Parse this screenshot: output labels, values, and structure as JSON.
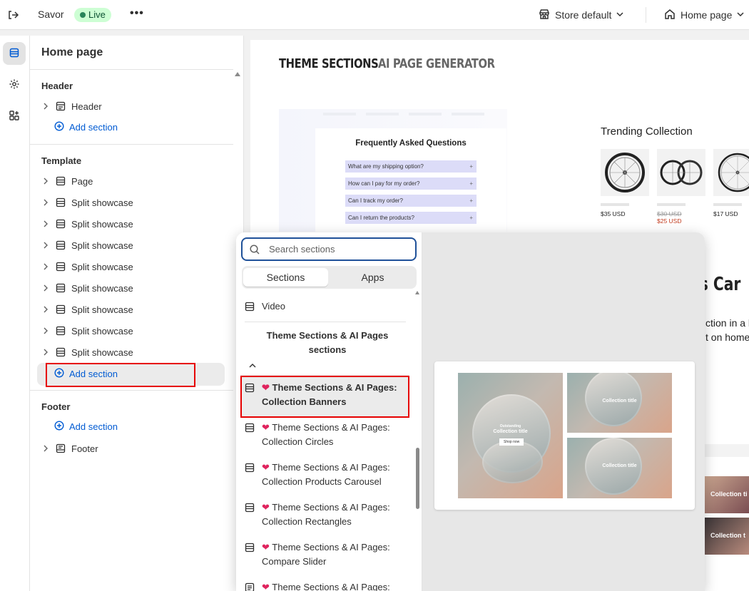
{
  "topbar": {
    "store_name": "Savor",
    "status": "Live",
    "more": "•••",
    "theme_label": "Store default",
    "page_label": "Home page"
  },
  "sidebar": {
    "title": "Home page",
    "header_group": "Header",
    "header_item": "Header",
    "template_group": "Template",
    "template_items": [
      "Page",
      "Split showcase",
      "Split showcase",
      "Split showcase",
      "Split showcase",
      "Split showcase",
      "Split showcase",
      "Split showcase",
      "Split showcase"
    ],
    "footer_group": "Footer",
    "footer_item": "Footer",
    "add_section": "Add section"
  },
  "preview": {
    "tab1": "THEME SECTIONS",
    "tab2": "AI PAGE GENERATOR",
    "faq_title": "Frequently Asked Questions",
    "faq_items": [
      "What are my shipping option?",
      "How can I pay for my order?",
      "Can I track my order?",
      "Can I return the products?"
    ],
    "trending_title": "Trending Collection",
    "prices": [
      "$35 USD",
      "$30 USD",
      "$25 USD",
      "$17 USD"
    ],
    "big_heading": "ts Car",
    "body_line1": "ction in a h",
    "body_line2": "t on home",
    "img_label1": "Collection ti",
    "img_label2": "Collection t"
  },
  "picker": {
    "search_placeholder": "Search sections",
    "tab_sections": "Sections",
    "tab_apps": "Apps",
    "video_item": "Video",
    "group_title": "Theme Sections & AI Pages sections",
    "items": [
      {
        "line1": "Theme Sections & AI Pages:",
        "line2": "Collection Banners"
      },
      {
        "line1": "Theme Sections & AI Pages:",
        "line2": "Collection Circles"
      },
      {
        "line1": "Theme Sections & AI Pages:",
        "line2": "Collection Products Carousel"
      },
      {
        "line1": "Theme Sections & AI Pages:",
        "line2": "Collection Rectangles"
      },
      {
        "line1": "Theme Sections & AI Pages:",
        "line2": "Compare Slider"
      },
      {
        "line1": "Theme Sections & AI Pages:",
        "line2": ""
      }
    ],
    "preview_tiles": {
      "main_kicker": "Outstanding",
      "main_title": "Collection title",
      "main_button": "Shop now",
      "tile_title": "Collection title"
    }
  },
  "colors": {
    "accent": "#005bd3",
    "live_bg": "#cdfed4",
    "highlight_border": "#e60000",
    "heart": "#e0245e"
  }
}
